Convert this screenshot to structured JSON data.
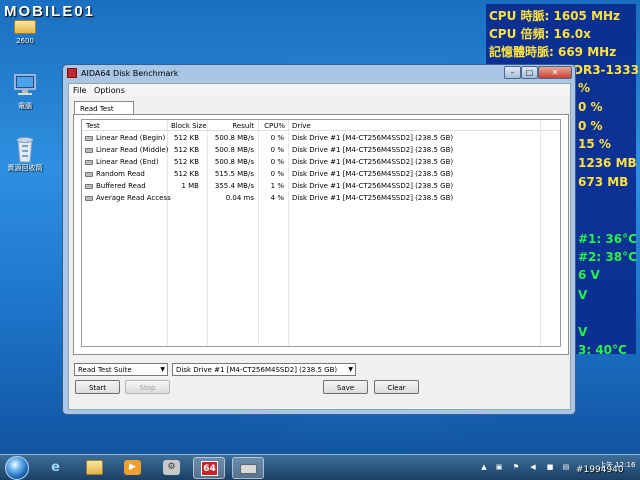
{
  "watermark": "MOBILE01",
  "desktop_icons": [
    {
      "label": "2600"
    },
    {
      "label": "電腦"
    },
    {
      "label": "資源回收筒"
    }
  ],
  "osd": [
    {
      "text": "CPU 時脈: 1605 MHz",
      "color": "yellow"
    },
    {
      "text": "CPU 倍頻: 16.0x",
      "color": "yellow"
    },
    {
      "text": "記憶體時脈: 669 MHz",
      "color": "yellow"
    },
    {
      "text": "DR3-1333",
      "color": "yellow"
    },
    {
      "text": "%",
      "color": "yellow"
    },
    {
      "text": "0 %",
      "color": "yellow"
    },
    {
      "text": "0 %",
      "color": "yellow"
    },
    {
      "text": "15 %",
      "color": "yellow"
    },
    {
      "text": "1236 MB",
      "color": "yellow"
    },
    {
      "text": "673 MB",
      "color": "yellow"
    },
    {
      "text": "#1: 36°C",
      "color": "green"
    },
    {
      "text": "#2: 38°C",
      "color": "green"
    },
    {
      "text": "6 V",
      "color": "green"
    },
    {
      "text": "V",
      "color": "green"
    },
    {
      "text": "V",
      "color": "green"
    },
    {
      "text": "3: 40°C",
      "color": "green"
    }
  ],
  "window": {
    "title": "AIDA64 Disk Benchmark",
    "menu": [
      "File",
      "Options"
    ],
    "tab": "Read Test Suite",
    "columns": [
      "Test",
      "Block Size",
      "Result",
      "CPU%",
      "Drive"
    ],
    "rows": [
      {
        "test": "Linear Read (Begin)",
        "block": "512 KB",
        "result": "500.8 MB/s",
        "cpu": "0 %",
        "drive": "Disk Drive #1  [M4-CT256M4SSD2]  (238.5 GB)"
      },
      {
        "test": "Linear Read (Middle)",
        "block": "512 KB",
        "result": "500.8 MB/s",
        "cpu": "0 %",
        "drive": "Disk Drive #1  [M4-CT256M4SSD2]  (238.5 GB)"
      },
      {
        "test": "Linear Read (End)",
        "block": "512 KB",
        "result": "500.8 MB/s",
        "cpu": "0 %",
        "drive": "Disk Drive #1  [M4-CT256M4SSD2]  (238.5 GB)"
      },
      {
        "test": "Random Read",
        "block": "512 KB",
        "result": "515.5 MB/s",
        "cpu": "0 %",
        "drive": "Disk Drive #1  [M4-CT256M4SSD2]  (238.5 GB)"
      },
      {
        "test": "Buffered Read",
        "block": "1 MB",
        "result": "355.4 MB/s",
        "cpu": "1 %",
        "drive": "Disk Drive #1  [M4-CT256M4SSD2]  (238.5 GB)"
      },
      {
        "test": "Average Read Access",
        "block": "",
        "result": "0.04 ms",
        "cpu": "4 %",
        "drive": "Disk Drive #1  [M4-CT256M4SSD2]  (238.5 GB)"
      }
    ],
    "test_select": "Read Test Suite",
    "drive_select": "Disk Drive #1  [M4-CT256M4SSD2]  (238.5 GB)",
    "buttons": {
      "start": "Start",
      "stop": "Stop",
      "save": "Save",
      "clear": "Clear"
    }
  },
  "taskbar": {
    "apps": [
      "internet-explorer",
      "file-explorer",
      "media-player",
      "system-tool",
      "aida64",
      "disk-benchmark"
    ],
    "aida_label": "64",
    "time": "上午 12:16",
    "badge": "#1994940"
  },
  "colors": {
    "osd_yellow": "#ffe23c",
    "osd_green": "#26f34a",
    "osd_bg": "#0a2a8f"
  }
}
